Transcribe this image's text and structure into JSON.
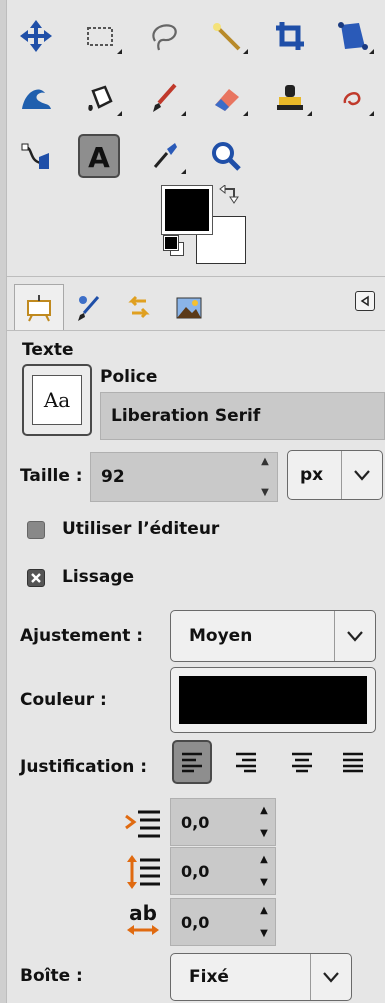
{
  "toolbox": {
    "tools": [
      {
        "name": "move-tool",
        "icon": "move-icon"
      },
      {
        "name": "rect-select-tool",
        "icon": "rect-select-icon"
      },
      {
        "name": "free-select-tool",
        "icon": "lasso-icon"
      },
      {
        "name": "fuzzy-select-tool",
        "icon": "magic-wand-icon"
      },
      {
        "name": "crop-tool",
        "icon": "crop-icon"
      },
      {
        "name": "transform-tool",
        "icon": "unified-transform-icon"
      },
      {
        "name": "warp-tool",
        "icon": "warp-icon"
      },
      {
        "name": "bucket-fill-tool",
        "icon": "bucket-fill-icon"
      },
      {
        "name": "paintbrush-tool",
        "icon": "paintbrush-icon"
      },
      {
        "name": "eraser-tool",
        "icon": "eraser-icon"
      },
      {
        "name": "clone-tool",
        "icon": "clone-stamp-icon"
      },
      {
        "name": "smudge-tool",
        "icon": "smudge-icon"
      },
      {
        "name": "paths-tool",
        "icon": "paths-icon"
      },
      {
        "name": "text-tool",
        "icon": "text-icon",
        "active": true
      },
      {
        "name": "color-picker-tool",
        "icon": "color-picker-icon"
      },
      {
        "name": "zoom-tool",
        "icon": "zoom-icon"
      }
    ],
    "fg_color": "#000000",
    "bg_color": "#ffffff"
  },
  "tabs": [
    {
      "name": "tab-tool-options",
      "icon": "tool-options-icon",
      "active": true
    },
    {
      "name": "tab-brushes",
      "icon": "brush-icon"
    },
    {
      "name": "tab-undo-history",
      "icon": "undo-history-icon"
    },
    {
      "name": "tab-images",
      "icon": "images-icon"
    }
  ],
  "options": {
    "section_title": "Texte",
    "font_label": "Police",
    "font_preview": "Aa",
    "font_value": "Liberation Serif",
    "size_label": "Taille :",
    "size_value": "92",
    "size_unit": "px",
    "use_editor_label": "Utiliser l’éditeur",
    "use_editor_checked": false,
    "antialias_label": "Lissage",
    "antialias_checked": true,
    "hinting_label": "Ajustement :",
    "hinting_value": "Moyen",
    "color_label": "Couleur :",
    "color_value": "#000000",
    "justify_label": "Justification :",
    "justify_options": [
      "justify-left",
      "justify-right",
      "justify-center",
      "justify-fill"
    ],
    "justify_active": "justify-left",
    "indent_value": "0,0",
    "line_spacing_value": "0,0",
    "letter_spacing_value": "0,0",
    "box_label": "Boîte :",
    "box_value": "Fixé"
  }
}
